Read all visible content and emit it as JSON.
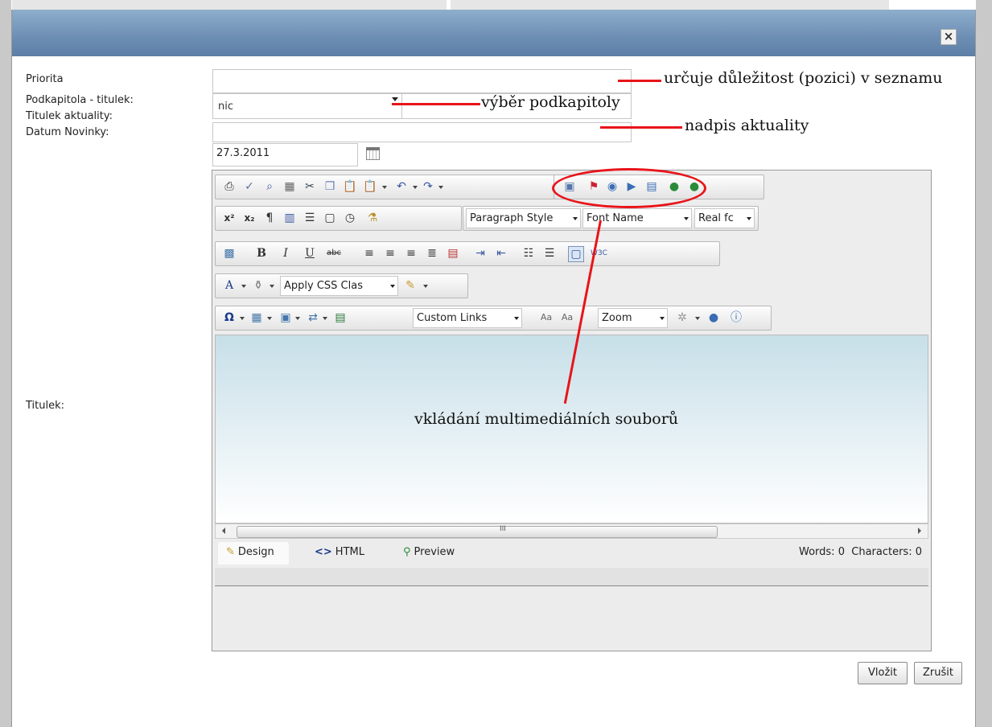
{
  "form": {
    "priority_label": "Priorita",
    "subchapter_label": "Podkapitola - titulek:",
    "subchapter_value": "nic",
    "news_title_label": "Titulek aktuality:",
    "date_label": "Datum Novinky:",
    "date_value": "27.3.2011",
    "title_label": "Titulek:"
  },
  "toolbar": {
    "paragraph_style": "Paragraph Style",
    "font_name": "Font Name",
    "real_font": "Real fc",
    "apply_css": "Apply CSS Clas",
    "custom_links": "Custom Links",
    "zoom": "Zoom"
  },
  "editor": {
    "modes": [
      "Design",
      "HTML",
      "Preview"
    ],
    "word_count": "Words: 0",
    "char_count": "Characters: 0",
    "scroll_grip": "III"
  },
  "buttons": {
    "insert": "Vložit",
    "cancel": "Zrušit",
    "close": "×"
  },
  "annotations": {
    "priority_note": "určuje důležitost (pozici) v seznamu",
    "subchapter_note": "výběr podkapitoly",
    "title_note": "nadpis aktuality",
    "media_note": "vkládání multimediálních souborů"
  },
  "colors": {
    "annotation_red": "#e8141a",
    "titlebar": "#6d8eb3"
  }
}
